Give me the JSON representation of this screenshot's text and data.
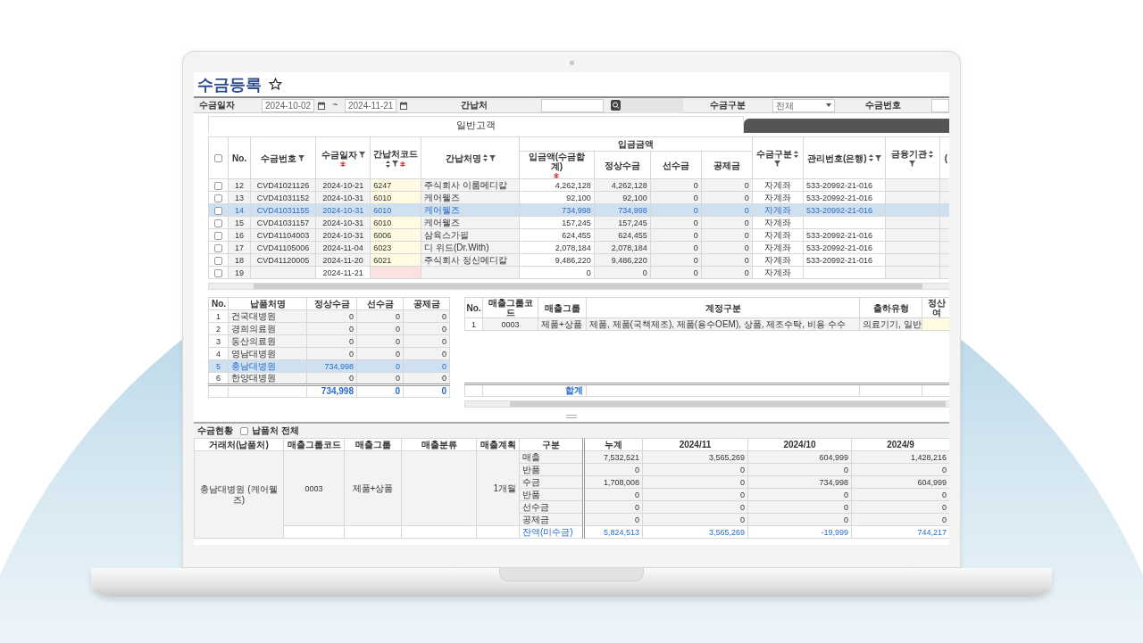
{
  "title": "수금등록",
  "favorite": false,
  "filters": {
    "date_label": "수금일자",
    "date_from": "2024-10-02",
    "date_sep": "~",
    "date_to": "2024-11-21",
    "client_label": "간납처",
    "type_label": "수금구분",
    "type_value": "전체",
    "number_label": "수금번호"
  },
  "customer_tabs": [
    {
      "label": "일반고객",
      "selected": true
    }
  ],
  "receipts": {
    "all_checked": false,
    "group_label": "입금금액",
    "columns": [
      {
        "label": "No.",
        "sort": false,
        "filter": false,
        "required": false
      },
      {
        "label": "수금번호",
        "sort": false,
        "filter": true,
        "required": false
      },
      {
        "label": "수금일자",
        "sort": false,
        "filter": true,
        "required": true
      },
      {
        "label": "간납처코드",
        "sort": true,
        "filter": true,
        "required": true
      },
      {
        "label": "간납처명",
        "sort": true,
        "filter": true,
        "required": false
      },
      {
        "label": "입금액(수금합계)",
        "sort": false,
        "filter": false,
        "required": true
      },
      {
        "label": "정상수금",
        "sort": false,
        "filter": false,
        "required": false
      },
      {
        "label": "선수금",
        "sort": false,
        "filter": false,
        "required": false
      },
      {
        "label": "공제금",
        "sort": false,
        "filter": false,
        "required": false
      },
      {
        "label": "수금구분",
        "sort": true,
        "filter": true,
        "required": false
      },
      {
        "label": "관리번호(은행)",
        "sort": true,
        "filter": true,
        "required": false
      },
      {
        "label": "금융기관",
        "sort": true,
        "filter": true,
        "required": false
      },
      {
        "label": "(",
        "sort": false,
        "filter": false,
        "required": false
      }
    ],
    "rows": [
      {
        "checked": false,
        "selected": false,
        "code_missing": false,
        "no": "12",
        "receipt_no": "CVD41021126",
        "date": "2024-10-21",
        "client_code": "6247",
        "client_name": "주식회사 이룸메디칼",
        "amount": "4,262,128",
        "normal": "4,262,128",
        "advance": "0",
        "deduction": "0",
        "method": "자계좌",
        "account": "533-20992-21-016"
      },
      {
        "checked": false,
        "selected": false,
        "code_missing": false,
        "no": "13",
        "receipt_no": "CVD41031152",
        "date": "2024-10-31",
        "client_code": "6010",
        "client_name": "케어웰즈",
        "amount": "92,100",
        "normal": "92,100",
        "advance": "0",
        "deduction": "0",
        "method": "자계좌",
        "account": "533-20992-21-016"
      },
      {
        "checked": false,
        "selected": true,
        "code_missing": false,
        "no": "14",
        "receipt_no": "CVD41031155",
        "date": "2024-10-31",
        "client_code": "6010",
        "client_name": "케어웰즈",
        "amount": "734,998",
        "normal": "734,998",
        "advance": "0",
        "deduction": "0",
        "method": "자계좌",
        "account": "533-20992-21-016"
      },
      {
        "checked": false,
        "selected": false,
        "code_missing": false,
        "no": "15",
        "receipt_no": "CVD41031157",
        "date": "2024-10-31",
        "client_code": "6010",
        "client_name": "케어웰즈",
        "amount": "157,245",
        "normal": "157,245",
        "advance": "0",
        "deduction": "0",
        "method": "자계좌"
      },
      {
        "checked": false,
        "selected": false,
        "code_missing": false,
        "no": "16",
        "receipt_no": "CVD41104003",
        "date": "2024-10-31",
        "client_code": "6006",
        "client_name": "삼육스가필",
        "amount": "624,455",
        "normal": "624,455",
        "advance": "0",
        "deduction": "0",
        "method": "자계좌",
        "account": "533-20992-21-016"
      },
      {
        "checked": false,
        "selected": false,
        "code_missing": false,
        "no": "17",
        "receipt_no": "CVD41105006",
        "date": "2024-11-04",
        "client_code": "6023",
        "client_name": "디 위드(Dr.With)",
        "amount": "2,078,184",
        "normal": "2,078,184",
        "advance": "0",
        "deduction": "0",
        "method": "자계좌",
        "account": "533-20992-21-016"
      },
      {
        "checked": false,
        "selected": false,
        "code_missing": false,
        "no": "18",
        "receipt_no": "CVD41120005",
        "date": "2024-11-20",
        "client_code": "6021",
        "client_name": "주식회사 정신메디칼",
        "amount": "9,486,220",
        "normal": "9,486,220",
        "advance": "0",
        "deduction": "0",
        "method": "자계좌",
        "account": "533-20992-21-016"
      },
      {
        "checked": false,
        "selected": false,
        "code_missing": true,
        "no": "19",
        "date": "2024-11-21",
        "amount": "0",
        "normal": "0",
        "advance": "0",
        "deduction": "0",
        "method": "자계좌"
      }
    ]
  },
  "deliveries": {
    "columns": [
      "No.",
      "납품처명",
      "정상수금",
      "선수금",
      "공제금"
    ],
    "rows": [
      {
        "selected": false,
        "no": "1",
        "name": "건국대병원",
        "normal": "0",
        "advance": "0",
        "deduction": "0"
      },
      {
        "selected": false,
        "no": "2",
        "name": "경희의료원",
        "normal": "0",
        "advance": "0",
        "deduction": "0"
      },
      {
        "selected": false,
        "no": "3",
        "name": "동산의료원",
        "normal": "0",
        "advance": "0",
        "deduction": "0"
      },
      {
        "selected": false,
        "no": "4",
        "name": "영남대병원",
        "normal": "0",
        "advance": "0",
        "deduction": "0"
      },
      {
        "selected": true,
        "no": "5",
        "name": "충남대병원",
        "normal": "734,998",
        "advance": "0",
        "deduction": "0"
      },
      {
        "selected": false,
        "no": "6",
        "name": "한양대병원",
        "normal": "0",
        "advance": "0",
        "deduction": "0"
      }
    ],
    "totals": {
      "normal": "734,998",
      "advance": "0",
      "deduction": "0"
    }
  },
  "sales_groups": {
    "columns": [
      "No.",
      "매출그룹코드",
      "매출그룹",
      "계정구분",
      "출하유형",
      "정산여"
    ],
    "rows": [
      {
        "no": "1",
        "code": "0003",
        "group": "제품+상품",
        "accounts": "제품, 제품(국책제조), 제품(용수OEM), 상품, 제조수탁, 비용 수수",
        "shipping": "의료기기, 일반"
      }
    ],
    "footer_label": "합계"
  },
  "status": {
    "title": "수금현황",
    "all_clients": {
      "label": "납품처 전체",
      "checked": false
    },
    "columns": [
      "거래처(납품처)",
      "매출그룹코드",
      "매출그룹",
      "매출분류",
      "매출계획",
      "구분",
      "누계",
      "2024/11",
      "2024/10",
      "2024/9"
    ],
    "client": "충남대병원 (케어웰즈)",
    "group_code": "0003",
    "group": "제품+상품",
    "plan": "1개월",
    "rows": [
      {
        "kind": "normal",
        "label": "매출",
        "values": [
          "7,532,521",
          "3,565,269",
          "604,999",
          "1,428,216"
        ]
      },
      {
        "kind": "normal",
        "label": "반품",
        "values": [
          "0",
          "0",
          "0",
          "0"
        ]
      },
      {
        "kind": "normal",
        "label": "수금",
        "values": [
          "1,708,008",
          "0",
          "734,998",
          "604,999"
        ]
      },
      {
        "kind": "normal",
        "label": "반품",
        "values": [
          "0",
          "0",
          "0",
          "0"
        ]
      },
      {
        "kind": "normal",
        "label": "선수금",
        "values": [
          "0",
          "0",
          "0",
          "0"
        ]
      },
      {
        "kind": "normal",
        "label": "공제금",
        "values": [
          "0",
          "0",
          "0",
          "0"
        ]
      },
      {
        "kind": "balance",
        "label": "잔액(미수금)",
        "values": [
          "5,824,513",
          "3,565,269",
          "-19,999",
          "744,217"
        ]
      }
    ]
  }
}
